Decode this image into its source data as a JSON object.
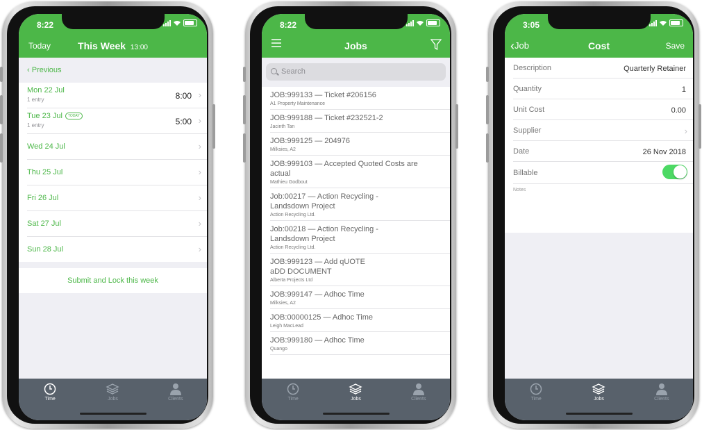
{
  "phones": [
    {
      "status_time": "8:22",
      "nav": {
        "left": "Today",
        "title": "This Week",
        "title_time": "13:00"
      },
      "previous_label": "Previous",
      "days": [
        {
          "label": "Mon 22 Jul",
          "sub": "1 entry",
          "hours": "8:00"
        },
        {
          "label": "Tue 23 Jul",
          "badge": "TODAY",
          "sub": "1 entry",
          "hours": "5:00"
        },
        {
          "label": "Wed 24 Jul"
        },
        {
          "label": "Thu 25 Jul"
        },
        {
          "label": "Fri 26 Jul"
        },
        {
          "label": "Sat 27 Jul"
        },
        {
          "label": "Sun 28 Jul"
        }
      ],
      "submit_label": "Submit and Lock this week",
      "active_tab": "Time"
    },
    {
      "status_time": "8:22",
      "nav": {
        "title": "Jobs"
      },
      "search_placeholder": "Search",
      "jobs": [
        {
          "title": "JOB:999133 — Ticket #206156",
          "client": "A1 Property Maintenance"
        },
        {
          "title": "JOB:999188 — Ticket #232521-2",
          "client": "Jacinth Tan"
        },
        {
          "title": "JOB:999125 — 204976",
          "client": "Milksies, A2"
        },
        {
          "title": "JOB:999103 — Accepted Quoted Costs are actual",
          "client": "Mathieu Godbout"
        },
        {
          "title": "Job:00217 — Action Recycling - Landsdown Project",
          "client": "Action Recycling Ltd."
        },
        {
          "title": "Job:00218 — Action Recycling - Landsdown Project",
          "client": "Action Recycling Ltd."
        },
        {
          "title": "JOB:999123 — Add qUOTE aDD DOCUMENT",
          "client": "Alberta Projects Ltd"
        },
        {
          "title": "JOB:999147 — Adhoc Time",
          "client": "Milksies, A2"
        },
        {
          "title": "JOB:00000125 — Adhoc Time",
          "client": "Leigh MacLead"
        },
        {
          "title": "JOB:999180 — Adhoc Time",
          "client": "Quango"
        }
      ],
      "active_tab": "Jobs"
    },
    {
      "status_time": "3:05",
      "nav": {
        "left": "Job",
        "title": "Cost",
        "right": "Save"
      },
      "fields": {
        "description": {
          "label": "Description",
          "value": "Quarterly Retainer"
        },
        "quantity": {
          "label": "Quantity",
          "value": "1"
        },
        "unit_cost": {
          "label": "Unit Cost",
          "value": "0.00"
        },
        "supplier": {
          "label": "Supplier"
        },
        "date": {
          "label": "Date",
          "value": "26 Nov 2018"
        },
        "billable": {
          "label": "Billable",
          "on": true
        }
      },
      "notes_placeholder": "Notes",
      "active_tab": "Jobs"
    }
  ],
  "tabs": [
    "Time",
    "Jobs",
    "Clients"
  ],
  "colors": {
    "brand_green": "#4cb748",
    "tabbar": "#58616b",
    "toggle_on": "#4cd964"
  }
}
